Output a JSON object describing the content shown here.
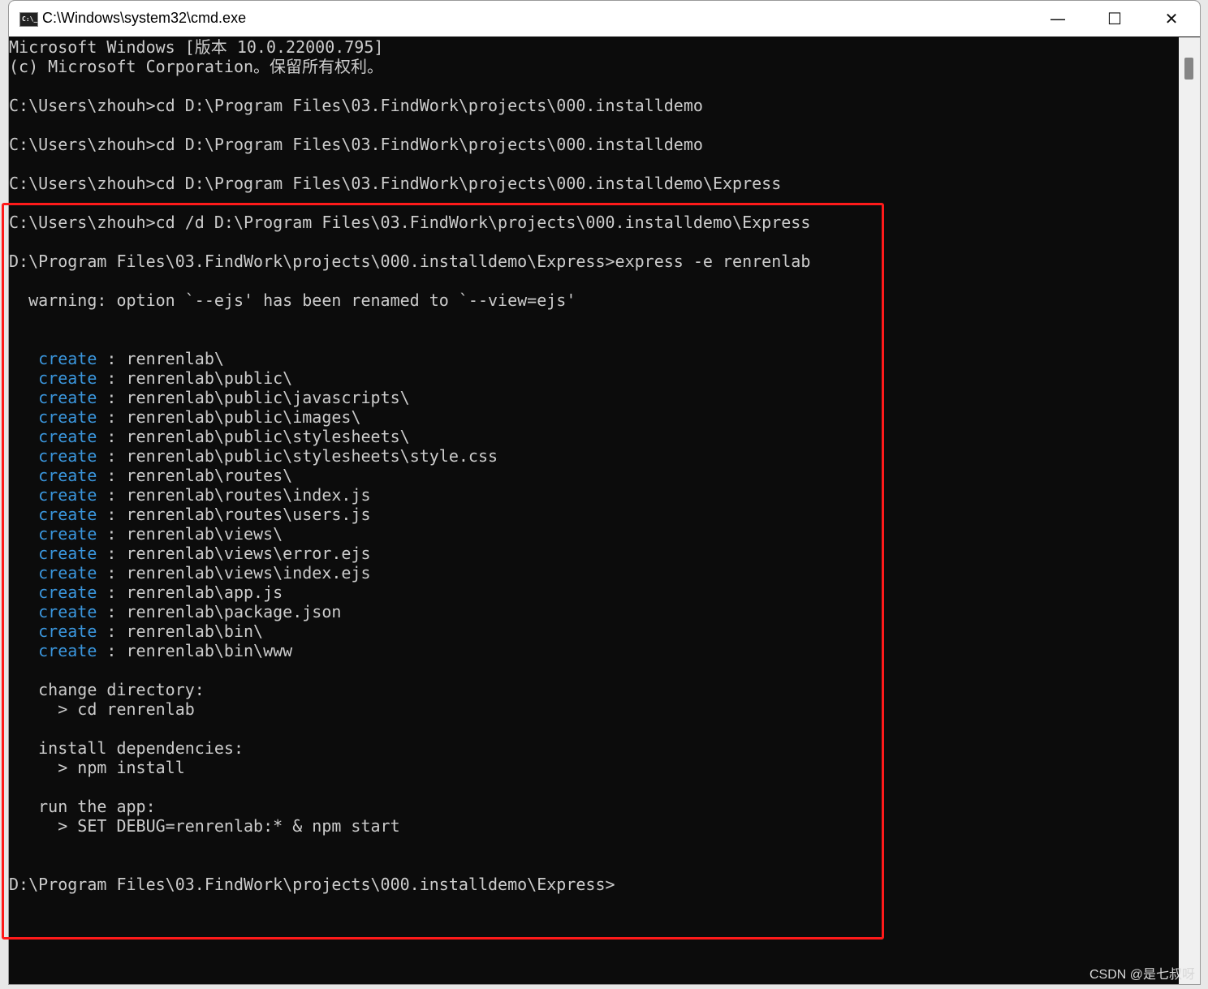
{
  "window": {
    "title": "C:\\Windows\\system32\\cmd.exe",
    "icon": "cmd-icon",
    "minimize": "—",
    "maximize": "☐",
    "close": "✕"
  },
  "colors": {
    "text": "#cccccc",
    "keyword": "#3a96dd",
    "highlight": "#ff1a1a",
    "background": "#0c0c0c"
  },
  "console": {
    "lines": [
      {
        "text": "Microsoft Windows [版本 10.0.22000.795]"
      },
      {
        "text": "(c) Microsoft Corporation。保留所有权利。"
      },
      {
        "text": ""
      },
      {
        "text": "C:\\Users\\zhouh>cd D:\\Program Files\\03.FindWork\\projects\\000.installdemo"
      },
      {
        "text": ""
      },
      {
        "text": "C:\\Users\\zhouh>cd D:\\Program Files\\03.FindWork\\projects\\000.installdemo"
      },
      {
        "text": ""
      },
      {
        "text": "C:\\Users\\zhouh>cd D:\\Program Files\\03.FindWork\\projects\\000.installdemo\\Express"
      },
      {
        "text": ""
      },
      {
        "text": "C:\\Users\\zhouh>cd /d D:\\Program Files\\03.FindWork\\projects\\000.installdemo\\Express"
      },
      {
        "text": ""
      },
      {
        "text": "D:\\Program Files\\03.FindWork\\projects\\000.installdemo\\Express>express -e renrenlab"
      },
      {
        "text": ""
      },
      {
        "text": "  warning: option `--ejs' has been renamed to `--view=ejs'"
      },
      {
        "text": ""
      },
      {
        "text": ""
      },
      {
        "kw": "create",
        "text": " : renrenlab\\"
      },
      {
        "kw": "create",
        "text": " : renrenlab\\public\\"
      },
      {
        "kw": "create",
        "text": " : renrenlab\\public\\javascripts\\"
      },
      {
        "kw": "create",
        "text": " : renrenlab\\public\\images\\"
      },
      {
        "kw": "create",
        "text": " : renrenlab\\public\\stylesheets\\"
      },
      {
        "kw": "create",
        "text": " : renrenlab\\public\\stylesheets\\style.css"
      },
      {
        "kw": "create",
        "text": " : renrenlab\\routes\\"
      },
      {
        "kw": "create",
        "text": " : renrenlab\\routes\\index.js"
      },
      {
        "kw": "create",
        "text": " : renrenlab\\routes\\users.js"
      },
      {
        "kw": "create",
        "text": " : renrenlab\\views\\"
      },
      {
        "kw": "create",
        "text": " : renrenlab\\views\\error.ejs"
      },
      {
        "kw": "create",
        "text": " : renrenlab\\views\\index.ejs"
      },
      {
        "kw": "create",
        "text": " : renrenlab\\app.js"
      },
      {
        "kw": "create",
        "text": " : renrenlab\\package.json"
      },
      {
        "kw": "create",
        "text": " : renrenlab\\bin\\"
      },
      {
        "kw": "create",
        "text": " : renrenlab\\bin\\www"
      },
      {
        "text": ""
      },
      {
        "text": "   change directory:"
      },
      {
        "text": "     > cd renrenlab"
      },
      {
        "text": ""
      },
      {
        "text": "   install dependencies:"
      },
      {
        "text": "     > npm install"
      },
      {
        "text": ""
      },
      {
        "text": "   run the app:"
      },
      {
        "text": "     > SET DEBUG=renrenlab:* & npm start"
      },
      {
        "text": ""
      },
      {
        "text": ""
      },
      {
        "text": "D:\\Program Files\\03.FindWork\\projects\\000.installdemo\\Express>"
      }
    ]
  },
  "watermark": "CSDN @是七叔呀"
}
